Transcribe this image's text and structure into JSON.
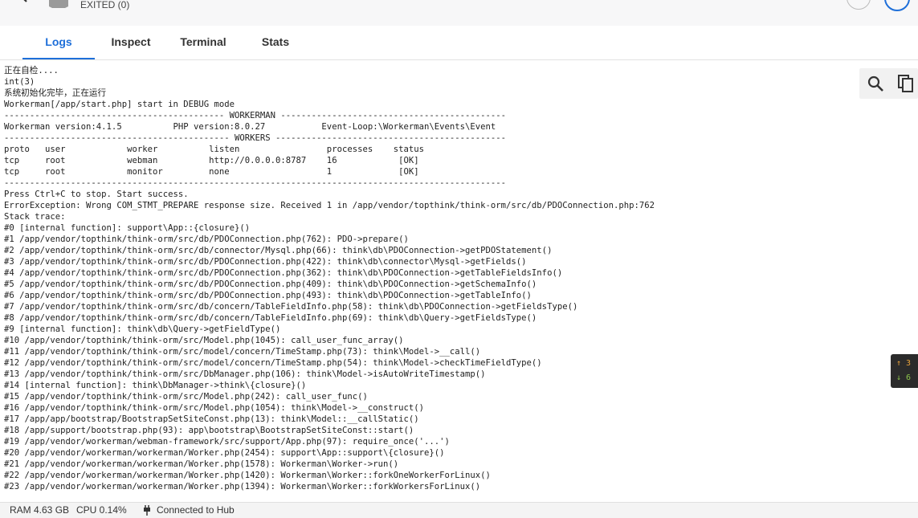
{
  "header": {
    "status": "EXITED (0)"
  },
  "tabs": [
    {
      "label": "Logs",
      "active": true
    },
    {
      "label": "Inspect",
      "active": false
    },
    {
      "label": "Terminal",
      "active": false
    },
    {
      "label": "Stats",
      "active": false
    }
  ],
  "log": {
    "lines": [
      "正在自检....",
      "int(3)",
      "系统初始化完毕，正在运行",
      "Workerman[/app/start.php] start in DEBUG mode",
      "------------------------------------------- WORKERMAN --------------------------------------------",
      "Workerman version:4.1.5          PHP version:8.0.27           Event-Loop:\\Workerman\\Events\\Event",
      "-------------------------------------------- WORKERS ---------------------------------------------",
      "proto   user            worker          listen                 processes    status",
      "tcp     root            webman          http://0.0.0.0:8787    16            [OK]",
      "tcp     root            monitor         none                   1             [OK]",
      "--------------------------------------------------------------------------------------------------",
      "Press Ctrl+C to stop. Start success.",
      "ErrorException: Wrong COM_STMT_PREPARE response size. Received 1 in /app/vendor/topthink/think-orm/src/db/PDOConnection.php:762",
      "Stack trace:",
      "#0 [internal function]: support\\App::{closure}()",
      "#1 /app/vendor/topthink/think-orm/src/db/PDOConnection.php(762): PDO->prepare()",
      "#2 /app/vendor/topthink/think-orm/src/db/connector/Mysql.php(66): think\\db\\PDOConnection->getPDOStatement()",
      "#3 /app/vendor/topthink/think-orm/src/db/PDOConnection.php(422): think\\db\\connector\\Mysql->getFields()",
      "#4 /app/vendor/topthink/think-orm/src/db/PDOConnection.php(362): think\\db\\PDOConnection->getTableFieldsInfo()",
      "#5 /app/vendor/topthink/think-orm/src/db/PDOConnection.php(409): think\\db\\PDOConnection->getSchemaInfo()",
      "#6 /app/vendor/topthink/think-orm/src/db/PDOConnection.php(493): think\\db\\PDOConnection->getTableInfo()",
      "#7 /app/vendor/topthink/think-orm/src/db/concern/TableFieldInfo.php(58): think\\db\\PDOConnection->getFieldsType()",
      "#8 /app/vendor/topthink/think-orm/src/db/concern/TableFieldInfo.php(69): think\\db\\Query->getFieldsType()",
      "#9 [internal function]: think\\db\\Query->getFieldType()",
      "#10 /app/vendor/topthink/think-orm/src/Model.php(1045): call_user_func_array()",
      "#11 /app/vendor/topthink/think-orm/src/model/concern/TimeStamp.php(73): think\\Model->__call()",
      "#12 /app/vendor/topthink/think-orm/src/model/concern/TimeStamp.php(54): think\\Model->checkTimeFieldType()",
      "#13 /app/vendor/topthink/think-orm/src/DbManager.php(106): think\\Model->isAutoWriteTimestamp()",
      "#14 [internal function]: think\\DbManager->think\\{closure}()",
      "#15 /app/vendor/topthink/think-orm/src/Model.php(242): call_user_func()",
      "#16 /app/vendor/topthink/think-orm/src/Model.php(1054): think\\Model->__construct()",
      "#17 /app/app/bootstrap/BootstrapSetSiteConst.php(13): think\\Model::__callStatic()",
      "#18 /app/support/bootstrap.php(93): app\\bootstrap\\BootstrapSetSiteConst::start()",
      "#19 /app/vendor/workerman/webman-framework/src/support/App.php(97): require_once('...')",
      "#20 /app/vendor/workerman/workerman/Worker.php(2454): support\\App::support\\{closure}()",
      "#21 /app/vendor/workerman/workerman/Worker.php(1578): Workerman\\Worker->run()",
      "#22 /app/vendor/workerman/workerman/Worker.php(1420): Workerman\\Worker::forkOneWorkerForLinux()",
      "#23 /app/vendor/workerman/workerman/Worker.php(1394): Workerman\\Worker::forkWorkersForLinux()"
    ]
  },
  "network": {
    "up": "↑ 3",
    "down": "↓ 6"
  },
  "footer": {
    "ram": "RAM 4.63 GB",
    "cpu": "CPU 0.14%",
    "hub": "Connected to Hub"
  },
  "colors": {
    "accent": "#1e6fd9"
  }
}
